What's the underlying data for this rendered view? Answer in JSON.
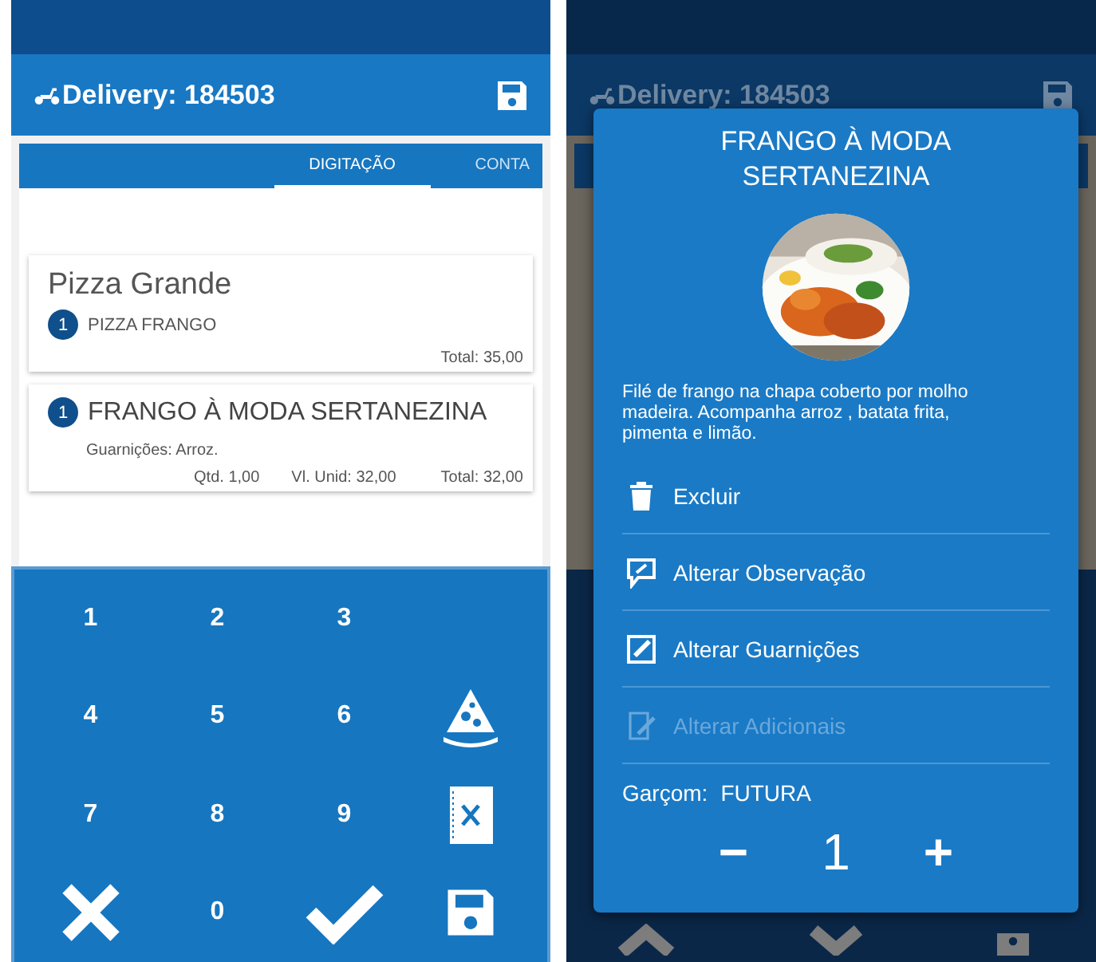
{
  "left_screen": {
    "app_bar": {
      "title": "Delivery: 184503"
    },
    "tabs": [
      {
        "label": "DIGITAÇÃO",
        "selected": true
      },
      {
        "label": "CONTA",
        "selected": false
      }
    ],
    "groups": [
      {
        "title": "Pizza Grande",
        "items": [
          {
            "qty": "1",
            "name": "PIZZA FRANGO",
            "total": "Total: 35,00"
          }
        ]
      },
      {
        "items": [
          {
            "qty": "1",
            "name": "FRANGO À MODA SERTANEZINA",
            "detail": "Guarnições: Arroz.",
            "quantity": "Qtd. 1,00",
            "unit_price": "Vl. Unid: 32,00",
            "total": "Total: 32,00"
          }
        ]
      }
    ],
    "keypad": [
      {
        "kind": "digit",
        "label": "1"
      },
      {
        "kind": "digit",
        "label": "2"
      },
      {
        "kind": "digit",
        "label": "3"
      },
      {
        "kind": "empty"
      },
      {
        "kind": "digit",
        "label": "4"
      },
      {
        "kind": "digit",
        "label": "5"
      },
      {
        "kind": "digit",
        "label": "6"
      },
      {
        "kind": "pizza"
      },
      {
        "kind": "digit",
        "label": "7"
      },
      {
        "kind": "digit",
        "label": "8"
      },
      {
        "kind": "digit",
        "label": "9"
      },
      {
        "kind": "menu"
      },
      {
        "kind": "cancel"
      },
      {
        "kind": "digit",
        "label": "0"
      },
      {
        "kind": "confirm"
      },
      {
        "kind": "save"
      }
    ]
  },
  "right_screen": {
    "app_bar": {
      "title": "Delivery: 184503"
    },
    "dialog": {
      "title": "FRANGO À MODA SERTANEZINA",
      "description": "Filé de frango na chapa coberto por molho madeira. Acompanha arroz , batata frita, pimenta e limão.",
      "actions": [
        {
          "kind": "delete",
          "label": "Excluir",
          "disabled": false
        },
        {
          "kind": "comment",
          "label": "Alterar Observação",
          "disabled": false
        },
        {
          "kind": "edit",
          "label": "Alterar Guarnições",
          "disabled": false
        },
        {
          "kind": "note",
          "label": "Alterar Adicionais",
          "disabled": true
        }
      ],
      "waiter_label": "Garçom:",
      "waiter": "FUTURA",
      "stepper": {
        "minus": "−",
        "value": "1",
        "plus": "+"
      }
    }
  }
}
